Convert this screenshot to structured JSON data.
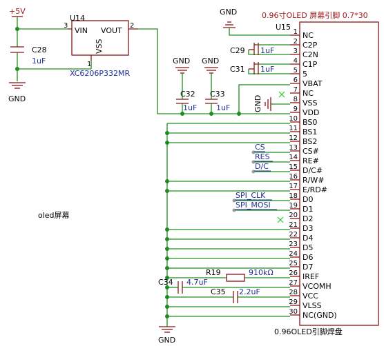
{
  "power": {
    "vin_label": "+5V"
  },
  "gnd_label": "GND",
  "u14": {
    "ref": "U14",
    "part": "XC6206P332MR",
    "pin_vin": "VIN",
    "pin_vout": "VOUT",
    "pin_vss": "VSS",
    "pin3": "3",
    "pin2": "2",
    "pin1": "1"
  },
  "c28": {
    "ref": "C28",
    "value": "1uF"
  },
  "c32": {
    "ref": "C32",
    "value": "1uF"
  },
  "c33": {
    "ref": "C33",
    "value": "1uF"
  },
  "c29": {
    "ref": "C29",
    "value": "1uF"
  },
  "c31": {
    "ref": "C31",
    "value": "1uF"
  },
  "c34": {
    "ref": "C34",
    "value": "4.7uF"
  },
  "c35": {
    "ref": "C35",
    "value": "2.2uF"
  },
  "r19": {
    "ref": "R19",
    "value": "910kΩ"
  },
  "u15": {
    "ref": "U15",
    "title": "0.96寸OLED 屏幕引脚 0.7*30",
    "footer": "0.96OLED引脚焊盘",
    "pins": [
      {
        "num": "1",
        "name": "NC"
      },
      {
        "num": "2",
        "name": "C2P"
      },
      {
        "num": "3",
        "name": "C2N"
      },
      {
        "num": "4",
        "name": "C1P"
      },
      {
        "num": "5",
        "name": "5"
      },
      {
        "num": "6",
        "name": "VBAT"
      },
      {
        "num": "7",
        "name": "NC"
      },
      {
        "num": "8",
        "name": "VSS"
      },
      {
        "num": "9",
        "name": "VDD"
      },
      {
        "num": "10",
        "name": "BS0"
      },
      {
        "num": "11",
        "name": "BS1"
      },
      {
        "num": "12",
        "name": "BS2"
      },
      {
        "num": "13",
        "name": "CS#"
      },
      {
        "num": "14",
        "name": "RE#"
      },
      {
        "num": "15",
        "name": "D/C#"
      },
      {
        "num": "16",
        "name": "R/W#"
      },
      {
        "num": "17",
        "name": "E/RD#"
      },
      {
        "num": "18",
        "name": "D0"
      },
      {
        "num": "19",
        "name": "D1"
      },
      {
        "num": "20",
        "name": "D2"
      },
      {
        "num": "21",
        "name": "D3"
      },
      {
        "num": "22",
        "name": "D4"
      },
      {
        "num": "23",
        "name": "D5"
      },
      {
        "num": "24",
        "name": "D6"
      },
      {
        "num": "25",
        "name": "D7"
      },
      {
        "num": "26",
        "name": "IREF"
      },
      {
        "num": "27",
        "name": "VCOMH"
      },
      {
        "num": "28",
        "name": "VCC"
      },
      {
        "num": "29",
        "name": "VLSS"
      },
      {
        "num": "30",
        "name": "NC(GND)"
      }
    ]
  },
  "net_labels": {
    "cs": "CS",
    "res": "RES",
    "dc": "D/C",
    "spi_clk": "SPI_CLK",
    "spi_mosi": "SPI_MOSI"
  },
  "section_label": "oled屏幕"
}
